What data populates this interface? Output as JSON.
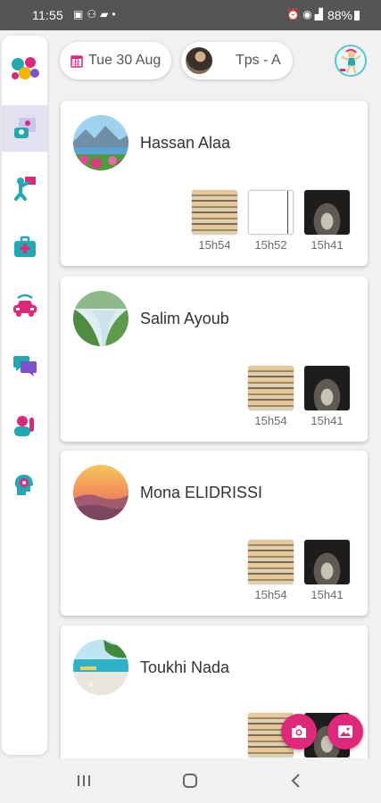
{
  "status_bar": {
    "time": "11:55",
    "battery": "88%",
    "left_icons": [
      "image-notification-icon",
      "person-notification-icon",
      "message-notification-icon",
      "dot-icon"
    ],
    "right_icons": [
      "alarm-icon",
      "wifi-icon",
      "signal-icon",
      "battery-icon"
    ]
  },
  "header": {
    "date": "Tue 30 Aug",
    "class_name": "Tps - A"
  },
  "sidebar": {
    "items": [
      {
        "name": "presence",
        "icon": "students-board-icon",
        "active": true
      },
      {
        "name": "activities",
        "icon": "teacher-board-icon",
        "active": false
      },
      {
        "name": "health",
        "icon": "medical-bag-icon",
        "active": false
      },
      {
        "name": "transport",
        "icon": "car-icon",
        "active": false
      },
      {
        "name": "messages",
        "icon": "chat-bubbles-icon",
        "active": false
      },
      {
        "name": "behavior",
        "icon": "raised-hand-icon",
        "active": false
      },
      {
        "name": "development",
        "icon": "brain-head-icon",
        "active": false
      }
    ]
  },
  "students": [
    {
      "name": "Hassan Alaa",
      "photos": [
        {
          "time": "15h54",
          "kind": "books"
        },
        {
          "time": "15h52",
          "kind": "blank"
        },
        {
          "time": "15h41",
          "kind": "dark"
        }
      ]
    },
    {
      "name": "Salim Ayoub",
      "photos": [
        {
          "time": "15h54",
          "kind": "books"
        },
        {
          "time": "15h41",
          "kind": "dark"
        }
      ]
    },
    {
      "name": "Mona ELIDRISSI",
      "photos": [
        {
          "time": "15h54",
          "kind": "books"
        },
        {
          "time": "15h41",
          "kind": "dark"
        }
      ]
    },
    {
      "name": "Toukhi Nada",
      "photos": []
    }
  ],
  "fabs": {
    "camera": "camera-icon",
    "gallery": "gallery-icon"
  },
  "colors": {
    "accent": "#e0287a",
    "teal": "#20a9b3",
    "status_bar": "#555556"
  }
}
